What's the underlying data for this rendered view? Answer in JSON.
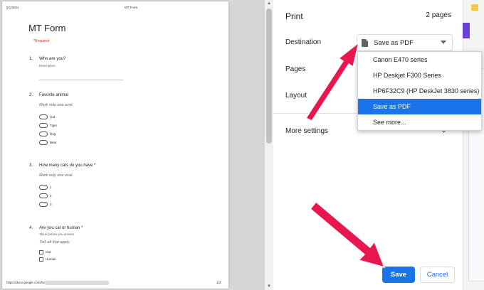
{
  "preview": {
    "date": "6/1/2021",
    "header_title": "MT Form",
    "form_title": "MT Form",
    "required_note": "*Required",
    "questions": [
      {
        "num": "1.",
        "text": "Who are you?",
        "desc": "Description"
      },
      {
        "num": "2.",
        "text": "Favorite animal",
        "instr": "Mark only one oval.",
        "options": [
          "Cat",
          "Tiger",
          "Dog",
          "Bear"
        ]
      },
      {
        "num": "3.",
        "text": "How many cats do you have *",
        "instr": "Mark only one oval.",
        "options": [
          "1",
          "2",
          "3"
        ]
      },
      {
        "num": "4.",
        "text": "Are you cat or human *",
        "desc": "Think before you answer",
        "instr": "Tick all that apply.",
        "options": [
          "Cat",
          "Human"
        ]
      }
    ],
    "footer_url": "https://docs.google.com/forms/",
    "page_number": "1/2"
  },
  "settings": {
    "title": "Print",
    "page_count": "2 pages",
    "destination_label": "Destination",
    "destination_value": "Save as PDF",
    "pages_label": "Pages",
    "layout_label": "Layout",
    "more_settings_label": "More settings",
    "icons": {
      "destination": "pdf-file-icon",
      "dropdown": "caret-down-icon",
      "more": "chevron-down-icon"
    }
  },
  "dropdown": {
    "items": [
      "Canon E470 series",
      "HP Deskjet F300 Series",
      "HP6F32C9 (HP DeskJet 3830 series)",
      "Save as PDF",
      "See more..."
    ],
    "selected_index": 3
  },
  "buttons": {
    "save": "Save",
    "cancel": "Cancel"
  },
  "colors": {
    "accent": "#1a73e8",
    "arrow": "#e8174e"
  }
}
